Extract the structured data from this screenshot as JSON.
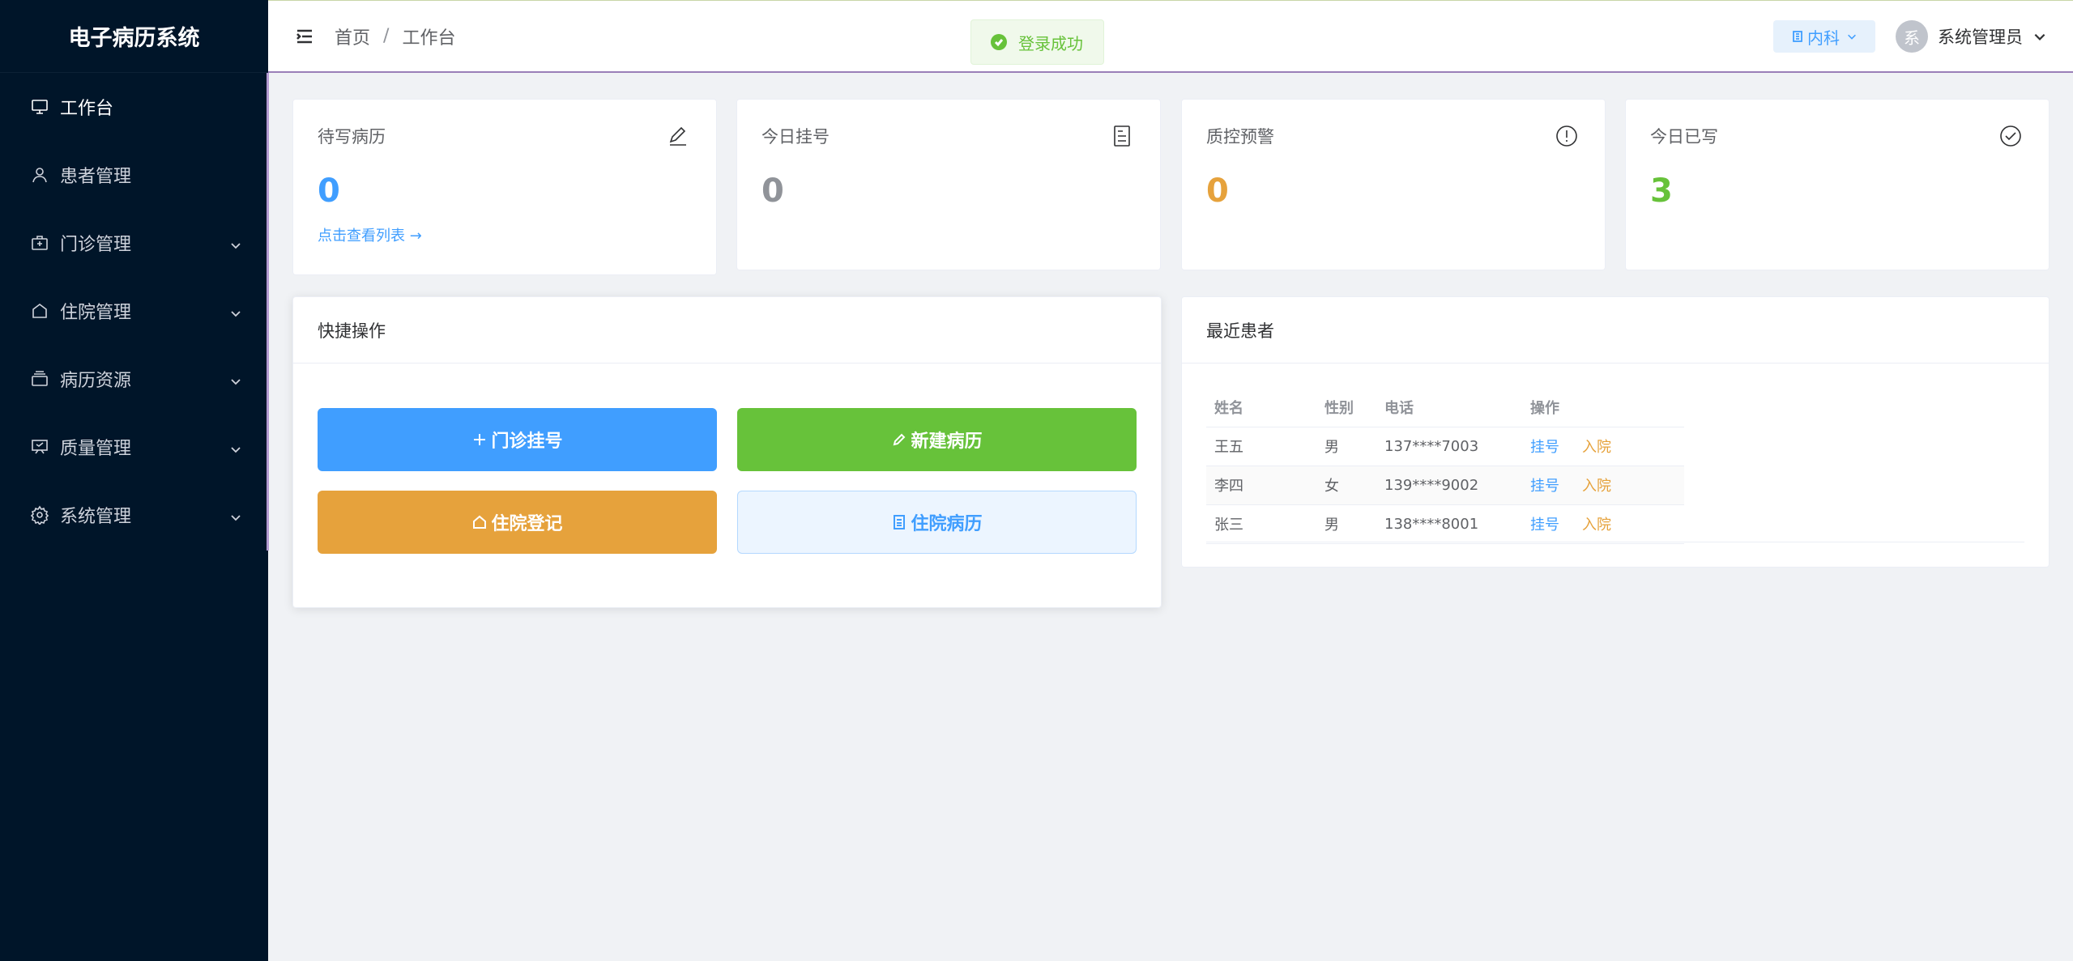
{
  "app": {
    "title": "电子病历系统"
  },
  "sidebar": {
    "items": [
      {
        "label": "工作台",
        "icon": "monitor-icon"
      },
      {
        "label": "患者管理",
        "icon": "user-icon"
      },
      {
        "label": "门诊管理",
        "icon": "first-aid-kit-icon"
      },
      {
        "label": "住院管理",
        "icon": "house-icon"
      },
      {
        "label": "病历资源",
        "icon": "files-icon"
      },
      {
        "label": "质量管理",
        "icon": "presentation-icon"
      },
      {
        "label": "系统管理",
        "icon": "gear-icon"
      }
    ]
  },
  "header": {
    "breadcrumb": [
      "首页",
      "工作台"
    ],
    "separator": "/",
    "toast": "登录成功",
    "department": "内科",
    "avatar_text": "系",
    "username": "系统管理员"
  },
  "stats": [
    {
      "label": "待写病历",
      "value": "0",
      "color": "#409eff",
      "link": "点击查看列表 →",
      "icon": "edit-pen-icon"
    },
    {
      "label": "今日挂号",
      "value": "0",
      "color": "#909399",
      "icon": "document-icon"
    },
    {
      "label": "质控预警",
      "value": "0",
      "color": "#e6a23c",
      "icon": "warning-circle-icon"
    },
    {
      "label": "今日已写",
      "value": "3",
      "color": "#67c23a",
      "icon": "check-circle-icon"
    }
  ],
  "quick": {
    "title": "快捷操作",
    "buttons": [
      {
        "label": "门诊挂号",
        "color": "#409eff",
        "icon": "plus-icon"
      },
      {
        "label": "新建病历",
        "color": "#67c23a",
        "icon": "edit-pen-icon"
      },
      {
        "label": "住院登记",
        "color": "#e6a23c",
        "icon": "house-icon"
      },
      {
        "label": "住院病历",
        "color": "#ecf5ff",
        "icon": "document-icon"
      }
    ]
  },
  "recent": {
    "title": "最近患者",
    "headers": [
      "姓名",
      "性别",
      "电话",
      "操作"
    ],
    "rows": [
      {
        "name": "王五",
        "gender": "男",
        "phone": "137****7003",
        "op1": "挂号",
        "op2": "入院"
      },
      {
        "name": "李四",
        "gender": "女",
        "phone": "139****9002",
        "op1": "挂号",
        "op2": "入院"
      },
      {
        "name": "张三",
        "gender": "男",
        "phone": "138****8001",
        "op1": "挂号",
        "op2": "入院"
      }
    ]
  }
}
